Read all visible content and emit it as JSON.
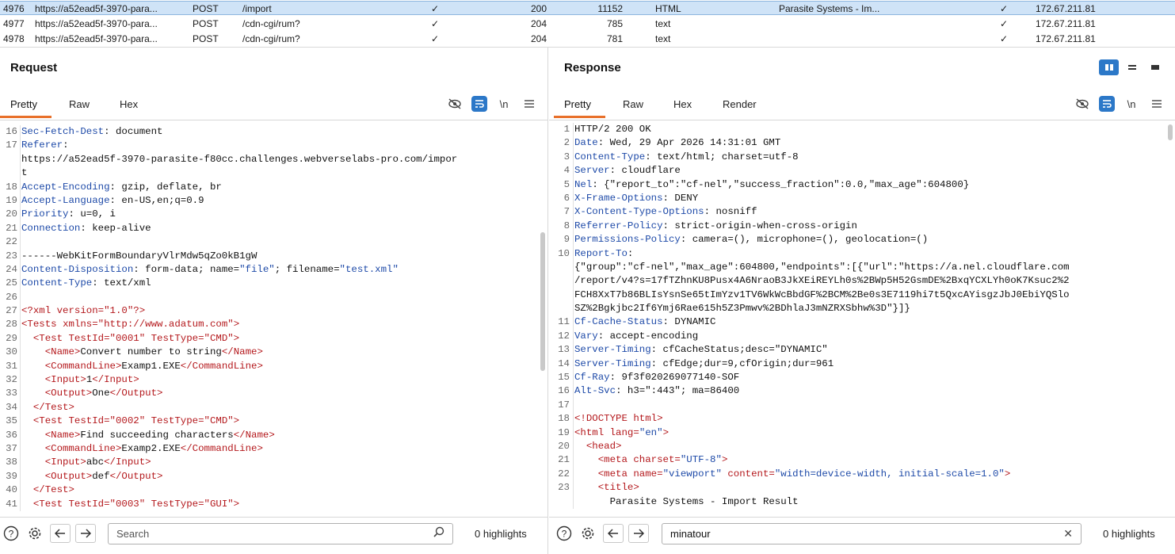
{
  "history": {
    "rows": [
      {
        "num": "4976",
        "host": "https://a52ead5f-3970-para...",
        "method": "POST",
        "url": "/import",
        "params": "✓",
        "status": "200",
        "length": "11152",
        "mime": "HTML",
        "title": "Parasite Systems - Im...",
        "tls": "✓",
        "ip": "172.67.211.81"
      },
      {
        "num": "4977",
        "host": "https://a52ead5f-3970-para...",
        "method": "POST",
        "url": "/cdn-cgi/rum?",
        "params": "✓",
        "status": "204",
        "length": "785",
        "mime": "text",
        "title": "",
        "tls": "✓",
        "ip": "172.67.211.81"
      },
      {
        "num": "4978",
        "host": "https://a52ead5f-3970-para...",
        "method": "POST",
        "url": "/cdn-cgi/rum?",
        "params": "✓",
        "status": "204",
        "length": "781",
        "mime": "text",
        "title": "",
        "tls": "✓",
        "ip": "172.67.211.81"
      }
    ]
  },
  "request": {
    "title": "Request",
    "tabs": [
      "Pretty",
      "Raw",
      "Hex"
    ],
    "active_tab": "Pretty",
    "newline_toggle": "\\n",
    "lines": [
      {
        "n": "16",
        "seg": [
          [
            "hn",
            "Sec-Fetch-Dest"
          ],
          [
            "hv",
            ": document"
          ]
        ]
      },
      {
        "n": "17",
        "seg": [
          [
            "hn",
            "Referer"
          ],
          [
            "hv",
            ":"
          ]
        ]
      },
      {
        "n": "",
        "seg": [
          [
            "hv",
            "https://a52ead5f-3970-parasite-f80cc.challenges.webverselabs-pro.com/impor"
          ]
        ]
      },
      {
        "n": "",
        "seg": [
          [
            "hv",
            "t"
          ]
        ]
      },
      {
        "n": "18",
        "seg": [
          [
            "hn",
            "Accept-Encoding"
          ],
          [
            "hv",
            ": gzip, deflate, br"
          ]
        ]
      },
      {
        "n": "19",
        "seg": [
          [
            "hn",
            "Accept-Language"
          ],
          [
            "hv",
            ": en-US,en;q=0.9"
          ]
        ]
      },
      {
        "n": "20",
        "seg": [
          [
            "hn",
            "Priority"
          ],
          [
            "hv",
            ": u=0, i"
          ]
        ]
      },
      {
        "n": "21",
        "seg": [
          [
            "hn",
            "Connection"
          ],
          [
            "hv",
            ": keep-alive"
          ]
        ]
      },
      {
        "n": "22",
        "seg": []
      },
      {
        "n": "23",
        "seg": [
          [
            "hv",
            "------WebKitFormBoundaryVlrMdw5qZo0kB1gW"
          ]
        ]
      },
      {
        "n": "24",
        "seg": [
          [
            "hn",
            "Content-Disposition"
          ],
          [
            "hv",
            ": form-data; name="
          ],
          [
            "str",
            "\"file\""
          ],
          [
            "hv",
            "; filename="
          ],
          [
            "str",
            "\"test.xml\""
          ]
        ]
      },
      {
        "n": "25",
        "seg": [
          [
            "hn",
            "Content-Type"
          ],
          [
            "hv",
            ": text/xml"
          ]
        ]
      },
      {
        "n": "26",
        "seg": []
      },
      {
        "n": "27",
        "seg": [
          [
            "tg",
            "<?xml version=\"1.0\"?>"
          ]
        ]
      },
      {
        "n": "28",
        "seg": [
          [
            "tg",
            "<Tests "
          ],
          [
            "at",
            "xmlns=\"http://www.adatum.com\""
          ],
          [
            "tg",
            ">"
          ]
        ]
      },
      {
        "n": "29",
        "seg": [
          [
            "tx",
            "  "
          ],
          [
            "tg",
            "<Test TestId=\"0001\" TestType=\"CMD\">"
          ]
        ]
      },
      {
        "n": "30",
        "seg": [
          [
            "tx",
            "    "
          ],
          [
            "tg",
            "<Name>"
          ],
          [
            "tx",
            "Convert number to string"
          ],
          [
            "tg",
            "</Name>"
          ]
        ]
      },
      {
        "n": "31",
        "seg": [
          [
            "tx",
            "    "
          ],
          [
            "tg",
            "<CommandLine>"
          ],
          [
            "tx",
            "Examp1.EXE"
          ],
          [
            "tg",
            "</CommandLine>"
          ]
        ]
      },
      {
        "n": "32",
        "seg": [
          [
            "tx",
            "    "
          ],
          [
            "tg",
            "<Input>"
          ],
          [
            "tx",
            "1"
          ],
          [
            "tg",
            "</Input>"
          ]
        ]
      },
      {
        "n": "33",
        "seg": [
          [
            "tx",
            "    "
          ],
          [
            "tg",
            "<Output>"
          ],
          [
            "tx",
            "One"
          ],
          [
            "tg",
            "</Output>"
          ]
        ]
      },
      {
        "n": "34",
        "seg": [
          [
            "tx",
            "  "
          ],
          [
            "tg",
            "</Test>"
          ]
        ]
      },
      {
        "n": "35",
        "seg": [
          [
            "tx",
            "  "
          ],
          [
            "tg",
            "<Test TestId=\"0002\" TestType=\"CMD\">"
          ]
        ]
      },
      {
        "n": "36",
        "seg": [
          [
            "tx",
            "    "
          ],
          [
            "tg",
            "<Name>"
          ],
          [
            "tx",
            "Find succeeding characters"
          ],
          [
            "tg",
            "</Name>"
          ]
        ]
      },
      {
        "n": "37",
        "seg": [
          [
            "tx",
            "    "
          ],
          [
            "tg",
            "<CommandLine>"
          ],
          [
            "tx",
            "Examp2.EXE"
          ],
          [
            "tg",
            "</CommandLine>"
          ]
        ]
      },
      {
        "n": "38",
        "seg": [
          [
            "tx",
            "    "
          ],
          [
            "tg",
            "<Input>"
          ],
          [
            "tx",
            "abc"
          ],
          [
            "tg",
            "</Input>"
          ]
        ]
      },
      {
        "n": "39",
        "seg": [
          [
            "tx",
            "    "
          ],
          [
            "tg",
            "<Output>"
          ],
          [
            "tx",
            "def"
          ],
          [
            "tg",
            "</Output>"
          ]
        ]
      },
      {
        "n": "40",
        "seg": [
          [
            "tx",
            "  "
          ],
          [
            "tg",
            "</Test>"
          ]
        ]
      },
      {
        "n": "41",
        "seg": [
          [
            "tx",
            "  "
          ],
          [
            "tg",
            "<Test TestId=\"0003\" TestType=\"GUI\">"
          ]
        ]
      }
    ],
    "search": {
      "placeholder": "Search",
      "value": "",
      "highlights": "0 highlights"
    }
  },
  "response": {
    "title": "Response",
    "tabs": [
      "Pretty",
      "Raw",
      "Hex",
      "Render"
    ],
    "active_tab": "Pretty",
    "newline_toggle": "\\n",
    "lines": [
      {
        "n": "1",
        "seg": [
          [
            "hv",
            "HTTP/2 200 OK"
          ]
        ]
      },
      {
        "n": "2",
        "seg": [
          [
            "hn",
            "Date"
          ],
          [
            "hv",
            ": Wed, 29 Apr 2026 14:31:01 GMT"
          ]
        ]
      },
      {
        "n": "3",
        "seg": [
          [
            "hn",
            "Content-Type"
          ],
          [
            "hv",
            ": text/html; charset=utf-8"
          ]
        ]
      },
      {
        "n": "4",
        "seg": [
          [
            "hn",
            "Server"
          ],
          [
            "hv",
            ": cloudflare"
          ]
        ]
      },
      {
        "n": "5",
        "seg": [
          [
            "hn",
            "Nel"
          ],
          [
            "hv",
            ": {\"report_to\":\"cf-nel\",\"success_fraction\":0.0,\"max_age\":604800}"
          ]
        ]
      },
      {
        "n": "6",
        "seg": [
          [
            "hn",
            "X-Frame-Options"
          ],
          [
            "hv",
            ": DENY"
          ]
        ]
      },
      {
        "n": "7",
        "seg": [
          [
            "hn",
            "X-Content-Type-Options"
          ],
          [
            "hv",
            ": nosniff"
          ]
        ]
      },
      {
        "n": "8",
        "seg": [
          [
            "hn",
            "Referrer-Policy"
          ],
          [
            "hv",
            ": strict-origin-when-cross-origin"
          ]
        ]
      },
      {
        "n": "9",
        "seg": [
          [
            "hn",
            "Permissions-Policy"
          ],
          [
            "hv",
            ": camera=(), microphone=(), geolocation=()"
          ]
        ]
      },
      {
        "n": "10",
        "seg": [
          [
            "hn",
            "Report-To"
          ],
          [
            "hv",
            ":"
          ]
        ]
      },
      {
        "n": "",
        "seg": [
          [
            "hv",
            "{\"group\":\"cf-nel\",\"max_age\":604800,\"endpoints\":[{\"url\":\"https://a.nel.cloudflare.com"
          ]
        ]
      },
      {
        "n": "",
        "seg": [
          [
            "hv",
            "/report/v4?s=17fTZhnKU8Pusx4A6NraoB3JkXEiREYLh0s%2BWp5H52GsmDE%2BxqYCXLYh0oK7Ksuc2%2"
          ]
        ]
      },
      {
        "n": "",
        "seg": [
          [
            "hv",
            "FCH8XxT7b86BLIsYsnSe65tImYzv1TV6WkWcBbdGF%2BCM%2Be0s3E7119hi7t5QxcAYisgzJbJ0EbiYQSlo"
          ]
        ]
      },
      {
        "n": "",
        "seg": [
          [
            "hv",
            "SZ%2Bgkjbc2If6Ymj6Rae615h5Z3Pmwv%2BDhlaJ3mNZRXSbhw%3D\"}]}"
          ]
        ]
      },
      {
        "n": "11",
        "seg": [
          [
            "hn",
            "Cf-Cache-Status"
          ],
          [
            "hv",
            ": DYNAMIC"
          ]
        ]
      },
      {
        "n": "12",
        "seg": [
          [
            "hn",
            "Vary"
          ],
          [
            "hv",
            ": accept-encoding"
          ]
        ]
      },
      {
        "n": "13",
        "seg": [
          [
            "hn",
            "Server-Timing"
          ],
          [
            "hv",
            ": cfCacheStatus;desc=\"DYNAMIC\""
          ]
        ]
      },
      {
        "n": "14",
        "seg": [
          [
            "hn",
            "Server-Timing"
          ],
          [
            "hv",
            ": cfEdge;dur=9,cfOrigin;dur=961"
          ]
        ]
      },
      {
        "n": "15",
        "seg": [
          [
            "hn",
            "Cf-Ray"
          ],
          [
            "hv",
            ": 9f3f020269077140-SOF"
          ]
        ]
      },
      {
        "n": "16",
        "seg": [
          [
            "hn",
            "Alt-Svc"
          ],
          [
            "hv",
            ": h3=\":443\"; ma=86400"
          ]
        ]
      },
      {
        "n": "17",
        "seg": []
      },
      {
        "n": "18",
        "seg": [
          [
            "tg",
            "<!DOCTYPE html>"
          ]
        ]
      },
      {
        "n": "19",
        "seg": [
          [
            "tg",
            "<html "
          ],
          [
            "at",
            "lang="
          ],
          [
            "str",
            "\"en\""
          ],
          [
            "tg",
            ">"
          ]
        ]
      },
      {
        "n": "20",
        "seg": [
          [
            "tx",
            "  "
          ],
          [
            "tg",
            "<head>"
          ]
        ]
      },
      {
        "n": "21",
        "seg": [
          [
            "tx",
            "    "
          ],
          [
            "tg",
            "<meta "
          ],
          [
            "at",
            "charset="
          ],
          [
            "str",
            "\"UTF-8\""
          ],
          [
            "tg",
            ">"
          ]
        ]
      },
      {
        "n": "22",
        "seg": [
          [
            "tx",
            "    "
          ],
          [
            "tg",
            "<meta "
          ],
          [
            "at",
            "name="
          ],
          [
            "str",
            "\"viewport\""
          ],
          [
            "at",
            " content="
          ],
          [
            "str",
            "\"width=device-width, initial-scale=1.0\""
          ],
          [
            "tg",
            ">"
          ]
        ]
      },
      {
        "n": "23",
        "seg": [
          [
            "tx",
            "    "
          ],
          [
            "tg",
            "<title>"
          ]
        ]
      },
      {
        "n": "",
        "seg": [
          [
            "tx",
            "      Parasite Systems - Import Result"
          ]
        ]
      }
    ],
    "search": {
      "placeholder": "",
      "value": "minatour",
      "highlights": "0 highlights"
    }
  }
}
